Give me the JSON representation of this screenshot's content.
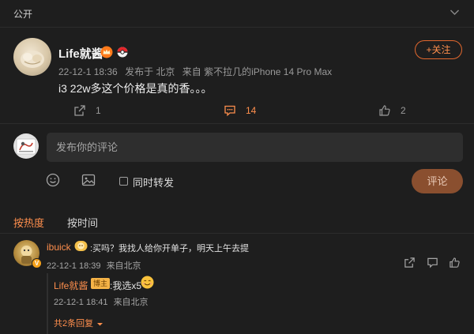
{
  "visibility_label": "公开",
  "post": {
    "author": "Life就酱",
    "time": "22-12-1 18:36",
    "publish_location": "发布于 北京",
    "source": "来自 紫不拉几的iPhone 14 Pro Max",
    "text": "i3 22w多这个价格是真的香。。。",
    "follow_label": "+关注",
    "share_count": "1",
    "comment_count": "14",
    "like_count": "2"
  },
  "composer": {
    "placeholder": "发布你的评论",
    "repost_label": "同时转发",
    "submit_label": "评论"
  },
  "sort": {
    "hot_label": "按热度",
    "time_label": "按时间"
  },
  "comment": {
    "user": "ibuick",
    "text": ":买吗？我找人给你开单子，明天上午去提",
    "time": "22-12-1 18:39",
    "location": "来自北京",
    "verified_mark": "V"
  },
  "reply": {
    "user": "Life就酱",
    "tag": "博主",
    "text": ":我选x5",
    "time": "22-12-1 18:41",
    "location": "来自北京",
    "more_label": "共2条回复"
  },
  "colors": {
    "accent": "#ff8f4d",
    "background": "#1e1e1e",
    "input_bg": "#2e2e2e"
  }
}
